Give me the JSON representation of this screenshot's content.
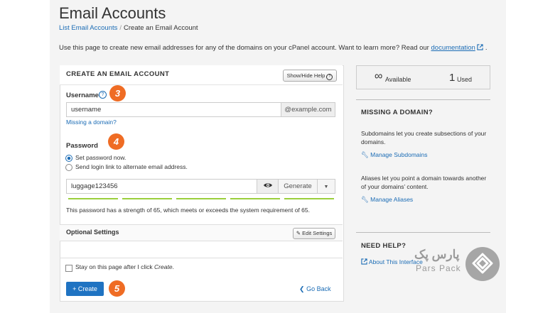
{
  "header": {
    "title": "Email Accounts",
    "breadcrumb": [
      "List Email Accounts",
      "Create an Email Account"
    ],
    "intro_text": "Use this page to create new email addresses for any of the domains on your cPanel account. Want to learn more? Read our ",
    "intro_link": "documentation",
    "intro_end": "."
  },
  "form": {
    "title": "CREATE AN EMAIL ACCOUNT",
    "help_button": "Show/Hide Help",
    "username_label": "Username",
    "username_value": "username",
    "domain_suffix": "@example.com",
    "missing_domain_link": "Missing a domain?",
    "password_label": "Password",
    "radio_set_now": "Set password now.",
    "radio_send_link": "Send login link to alternate email address.",
    "password_value": "luggage123456",
    "generate_button": "Generate",
    "password_strength": 65,
    "strength_text": "This password has a strength of 65, which meets or exceeds the system requirement of 65.",
    "optional_title": "Optional Settings",
    "edit_settings_button": "Edit Settings",
    "stay_prefix": "Stay on this page after I click ",
    "stay_italic": "Create",
    "stay_suffix": ".",
    "create_button": "+ Create",
    "go_back_link": "Go Back"
  },
  "steps": [
    "3",
    "4",
    "5"
  ],
  "sidebar": {
    "available_symbol": "∞",
    "available_label": "Available",
    "used_count": "1",
    "used_label": "Used",
    "missing_domain_heading": "MISSING A DOMAIN?",
    "subdomains_text": "Subdomains let you create subsections of your domains.",
    "manage_subdomains": "Manage Subdomains",
    "aliases_text": "Aliases let you point a domain towards another of your domains’ content.",
    "manage_aliases": "Manage Aliases",
    "need_help_heading": "NEED HELP?",
    "about_interface": "About This Interface"
  },
  "watermark": {
    "persian_text": "پارس پک",
    "english_text": "Pars Pack"
  },
  "colors": {
    "accent": "#1f73c2",
    "link": "#1b6cb5",
    "step_badge": "#ef6c24",
    "strength_meter": "#9bcf3c"
  }
}
